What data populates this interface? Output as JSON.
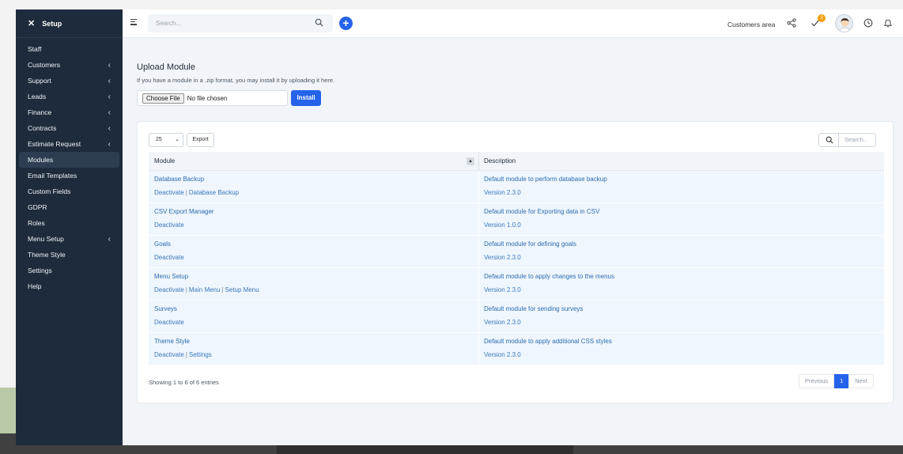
{
  "sidebar": {
    "title": "Setup",
    "close_glyph": "✕",
    "items": [
      {
        "label": "Staff",
        "chevron": ""
      },
      {
        "label": "Customers",
        "chevron": "‹"
      },
      {
        "label": "Support",
        "chevron": "‹"
      },
      {
        "label": "Leads",
        "chevron": "‹"
      },
      {
        "label": "Finance",
        "chevron": "‹"
      },
      {
        "label": "Contracts",
        "chevron": "‹"
      },
      {
        "label": "Estimate Request",
        "chevron": "‹"
      },
      {
        "label": "Modules",
        "chevron": ""
      },
      {
        "label": "Email Templates",
        "chevron": ""
      },
      {
        "label": "Custom Fields",
        "chevron": ""
      },
      {
        "label": "GDPR",
        "chevron": ""
      },
      {
        "label": "Roles",
        "chevron": ""
      },
      {
        "label": "Menu Setup",
        "chevron": "‹"
      },
      {
        "label": "Theme Style",
        "chevron": ""
      },
      {
        "label": "Settings",
        "chevron": ""
      },
      {
        "label": "Help",
        "chevron": ""
      }
    ],
    "active": "Modules"
  },
  "topbar": {
    "search_placeholder": "Search...",
    "plus_glyph": "+",
    "customers_area": "Customers area",
    "tasks_badge": "3"
  },
  "upload": {
    "title": "Upload Module",
    "description": "If you have a module in a .zip format, you may install it by uploading it here.",
    "choose_file": "Choose File",
    "no_file": "No file chosen",
    "install": "Install"
  },
  "table_controls": {
    "page_length": "25",
    "export": "Export",
    "search_placeholder": "Search.."
  },
  "table": {
    "headers": {
      "module": "Module",
      "description": "Description"
    },
    "rows": [
      {
        "name": "Database Backup",
        "actions": [
          "Deactivate",
          "Database Backup"
        ],
        "description": "Default module to perform database backup",
        "version": "Version 2.3.0"
      },
      {
        "name": "CSV Export Manager",
        "actions": [
          "Deactivate"
        ],
        "description": "Default module for Exporting data in CSV",
        "version": "Version 1.0.0"
      },
      {
        "name": "Goals",
        "actions": [
          "Deactivate"
        ],
        "description": "Default module for defining goals",
        "version": "Version 2.3.0"
      },
      {
        "name": "Menu Setup",
        "actions": [
          "Deactivate",
          "Main Menu",
          "Setup Menu"
        ],
        "description": "Default module to apply changes to the menus",
        "version": "Version 2.3.0"
      },
      {
        "name": "Surveys",
        "actions": [
          "Deactivate"
        ],
        "description": "Default module for sending surveys",
        "version": "Version 2.3.0"
      },
      {
        "name": "Theme Style",
        "actions": [
          "Deactivate",
          "Settings"
        ],
        "description": "Default module to apply additional CSS styles",
        "version": "Version 2.3.0"
      }
    ]
  },
  "footer": {
    "showing": "Showing 1 to 6 of 6 entries",
    "previous": "Previous",
    "current_page": "1",
    "next": "Next"
  },
  "colors": {
    "sidebar_bg": "#1e2b3c",
    "accent": "#2563eb",
    "link": "#2b6cb0",
    "badge": "#f59e0b"
  }
}
